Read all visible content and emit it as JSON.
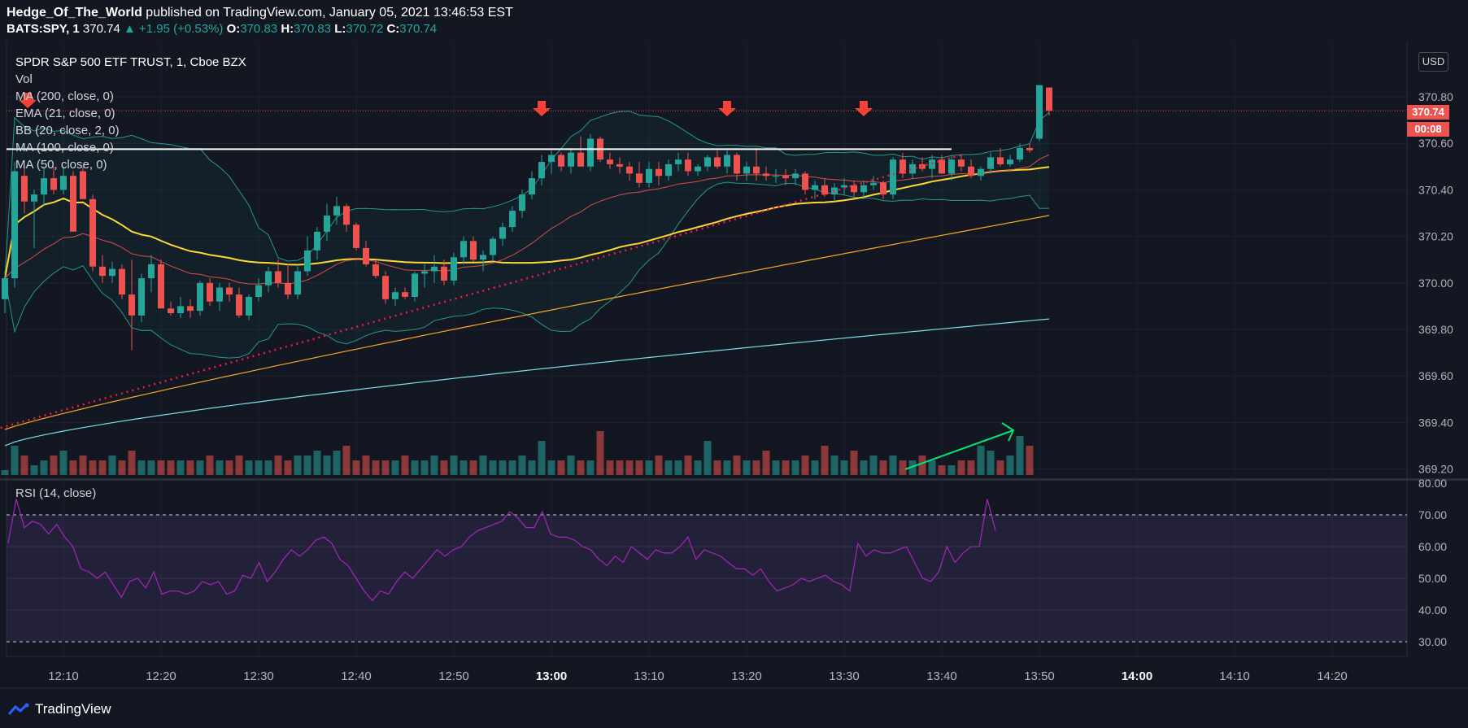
{
  "header": {
    "author": "Hedge_Of_The_World",
    "published": "published on TradingView.com, January 05, 2021 13:46:53 EST",
    "symbol": "BATS:SPY, 1",
    "last": "370.74",
    "change": "▲ +1.95 (+0.53%)",
    "o_label": "O:",
    "o_value": "370.83",
    "h_label": "H:",
    "h_value": "370.83",
    "l_label": "L:",
    "l_value": "370.72",
    "c_label": "C:",
    "c_value": "370.74"
  },
  "legend": {
    "title": "SPDR S&P 500 ETF TRUST, 1, Cboe BZX",
    "vol": "Vol",
    "ma200": "MA (200, close, 0)",
    "ema21": "EMA (21, close, 0)",
    "bb": "BB (20, close, 2, 0)",
    "ma100": "MA (100, close, 0)",
    "ma50": "MA (50, close, 0)"
  },
  "rsi_legend": "RSI (14, close)",
  "currency": "USD",
  "last_price_tag": "370.74",
  "countdown_tag": "00:08",
  "footer": {
    "brand": "TradingView"
  },
  "colors": {
    "background": "#131722",
    "up": "#26a69a",
    "down": "#ef5350",
    "ma200": "#80deea",
    "ema21": "#ef5350",
    "bb": "#26a69a",
    "ma100": "#f9a825",
    "ma50": "#fdd835",
    "rsi": "#9c27b0",
    "trendline": "#ff1744",
    "resistance": "#ffffff",
    "volume_arrow": "#00e676",
    "marker_arrow": "#f44336"
  },
  "chart_data": [
    {
      "type": "candlestick",
      "title": "SPDR S&P 500 ETF TRUST, 1, Cboe BZX",
      "y_ticks": [
        "369.20",
        "369.40",
        "369.60",
        "369.80",
        "370.00",
        "370.20",
        "370.40",
        "370.60",
        "370.80"
      ],
      "ylim": [
        369.17,
        371.0
      ],
      "x_ticks": [
        "12:10",
        "12:20",
        "12:30",
        "12:40",
        "12:50",
        "13:00",
        "13:10",
        "13:20",
        "13:30",
        "13:40",
        "13:50",
        "14:00",
        "14:10",
        "14:20"
      ],
      "x_bold_ticks": [
        "13:00",
        "14:00"
      ],
      "ohlc_start_time": "12:04",
      "ohlc": [
        [
          369.93,
          370.05,
          369.87,
          370.02
        ],
        [
          370.02,
          370.52,
          369.98,
          370.48
        ],
        [
          370.46,
          370.5,
          370.3,
          370.35
        ],
        [
          370.35,
          370.4,
          370.15,
          370.38
        ],
        [
          370.38,
          370.5,
          370.33,
          370.45
        ],
        [
          370.45,
          370.5,
          370.38,
          370.4
        ],
        [
          370.4,
          370.5,
          370.38,
          370.46
        ],
        [
          370.46,
          370.48,
          370.22,
          370.22
        ],
        [
          370.48,
          370.5,
          370.4,
          370.36
        ],
        [
          370.36,
          370.38,
          370.05,
          370.07
        ],
        [
          370.07,
          370.12,
          370.0,
          370.03
        ],
        [
          370.03,
          370.09,
          370.0,
          370.06
        ],
        [
          370.06,
          370.08,
          369.93,
          369.95
        ],
        [
          369.95,
          370.1,
          369.71,
          369.86
        ],
        [
          369.86,
          370.04,
          369.83,
          370.02
        ],
        [
          370.02,
          370.12,
          369.96,
          370.08
        ],
        [
          370.08,
          370.1,
          369.9,
          369.89
        ],
        [
          369.89,
          369.92,
          369.86,
          369.87
        ],
        [
          369.87,
          369.94,
          369.85,
          369.9
        ],
        [
          369.9,
          369.93,
          369.85,
          369.88
        ],
        [
          369.88,
          370.01,
          369.86,
          370.0
        ],
        [
          370.0,
          370.02,
          369.9,
          369.92
        ],
        [
          369.92,
          370.0,
          369.88,
          369.98
        ],
        [
          369.98,
          370.0,
          369.92,
          369.95
        ],
        [
          369.95,
          369.98,
          369.85,
          369.86
        ],
        [
          369.86,
          369.95,
          369.84,
          369.94
        ],
        [
          369.94,
          370.02,
          369.92,
          369.99
        ],
        [
          369.99,
          370.07,
          369.96,
          370.05
        ],
        [
          370.05,
          370.1,
          369.98,
          370.0
        ],
        [
          370.0,
          370.08,
          369.93,
          369.95
        ],
        [
          369.95,
          370.07,
          369.93,
          370.05
        ],
        [
          370.05,
          370.2,
          370.03,
          370.14
        ],
        [
          370.14,
          370.24,
          370.1,
          370.22
        ],
        [
          370.22,
          370.34,
          370.18,
          370.29
        ],
        [
          370.29,
          370.37,
          370.25,
          370.33
        ],
        [
          370.33,
          370.34,
          370.22,
          370.25
        ],
        [
          370.25,
          370.26,
          370.14,
          370.15
        ],
        [
          370.15,
          370.18,
          370.07,
          370.08
        ],
        [
          370.08,
          370.1,
          370.02,
          370.03
        ],
        [
          370.03,
          370.05,
          369.91,
          369.93
        ],
        [
          369.93,
          369.98,
          369.9,
          369.96
        ],
        [
          369.96,
          369.98,
          369.93,
          369.94
        ],
        [
          369.94,
          370.05,
          369.92,
          370.04
        ],
        [
          370.04,
          370.08,
          369.98,
          370.05
        ],
        [
          370.05,
          370.12,
          370.0,
          370.07
        ],
        [
          370.07,
          370.1,
          369.99,
          370.01
        ],
        [
          370.01,
          370.13,
          369.99,
          370.11
        ],
        [
          370.11,
          370.2,
          370.08,
          370.18
        ],
        [
          370.18,
          370.2,
          370.09,
          370.1
        ],
        [
          370.1,
          370.14,
          370.05,
          370.12
        ],
        [
          370.12,
          370.2,
          370.09,
          370.19
        ],
        [
          370.19,
          370.26,
          370.16,
          370.24
        ],
        [
          370.24,
          370.33,
          370.22,
          370.31
        ],
        [
          370.31,
          370.4,
          370.28,
          370.38
        ],
        [
          370.38,
          370.48,
          370.36,
          370.45
        ],
        [
          370.45,
          370.55,
          370.42,
          370.52
        ],
        [
          370.52,
          370.57,
          370.47,
          370.55
        ],
        [
          370.55,
          370.56,
          370.48,
          370.5
        ],
        [
          370.5,
          370.58,
          370.47,
          370.56
        ],
        [
          370.56,
          370.63,
          370.5,
          370.5
        ],
        [
          370.5,
          370.64,
          370.48,
          370.62
        ],
        [
          370.62,
          370.63,
          370.52,
          370.53
        ],
        [
          370.53,
          370.56,
          370.49,
          370.51
        ],
        [
          370.51,
          370.54,
          370.47,
          370.5
        ],
        [
          370.5,
          370.52,
          370.44,
          370.47
        ],
        [
          370.47,
          370.52,
          370.41,
          370.43
        ],
        [
          370.43,
          370.52,
          370.41,
          370.49
        ],
        [
          370.49,
          370.52,
          370.42,
          370.46
        ],
        [
          370.46,
          370.53,
          370.44,
          370.51
        ],
        [
          370.51,
          370.56,
          370.48,
          370.53
        ],
        [
          370.53,
          370.56,
          370.46,
          370.48
        ],
        [
          370.48,
          370.51,
          370.46,
          370.5
        ],
        [
          370.5,
          370.55,
          370.48,
          370.54
        ],
        [
          370.54,
          370.57,
          370.49,
          370.5
        ],
        [
          370.5,
          370.57,
          370.47,
          370.55
        ],
        [
          370.55,
          370.56,
          370.44,
          370.47
        ],
        [
          370.47,
          370.52,
          370.44,
          370.5
        ],
        [
          370.5,
          370.58,
          370.44,
          370.47
        ],
        [
          370.47,
          370.5,
          370.44,
          370.46
        ],
        [
          370.46,
          370.49,
          370.43,
          370.46
        ],
        [
          370.46,
          370.49,
          370.42,
          370.45
        ],
        [
          370.45,
          370.49,
          370.42,
          370.47
        ],
        [
          370.47,
          370.48,
          370.38,
          370.4
        ],
        [
          370.4,
          370.44,
          370.36,
          370.42
        ],
        [
          370.42,
          370.45,
          370.37,
          370.38
        ],
        [
          370.38,
          370.43,
          370.35,
          370.41
        ],
        [
          370.41,
          370.45,
          370.38,
          370.42
        ],
        [
          370.42,
          370.44,
          370.37,
          370.39
        ],
        [
          370.39,
          370.44,
          370.36,
          370.42
        ],
        [
          370.42,
          370.46,
          370.4,
          370.43
        ],
        [
          370.43,
          370.44,
          370.36,
          370.38
        ],
        [
          370.38,
          370.54,
          370.36,
          370.53
        ],
        [
          370.53,
          370.56,
          370.45,
          370.47
        ],
        [
          370.47,
          370.53,
          370.45,
          370.51
        ],
        [
          370.51,
          370.54,
          370.48,
          370.49
        ],
        [
          370.49,
          370.55,
          370.45,
          370.53
        ],
        [
          370.53,
          370.55,
          370.47,
          370.47
        ],
        [
          370.47,
          370.55,
          370.44,
          370.53
        ],
        [
          370.53,
          370.55,
          370.48,
          370.5
        ],
        [
          370.5,
          370.53,
          370.45,
          370.46
        ],
        [
          370.46,
          370.5,
          370.44,
          370.49
        ],
        [
          370.49,
          370.56,
          370.47,
          370.54
        ],
        [
          370.54,
          370.58,
          370.5,
          370.51
        ],
        [
          370.51,
          370.55,
          370.5,
          370.53
        ],
        [
          370.53,
          370.6,
          370.52,
          370.58
        ],
        [
          370.58,
          370.6,
          370.56,
          370.57
        ],
        [
          370.62,
          370.85,
          370.61,
          370.85
        ],
        [
          370.84,
          370.84,
          370.72,
          370.74
        ]
      ],
      "volume_ticks": [
        1,
        6,
        4,
        2,
        3,
        4,
        5,
        3,
        4,
        3,
        3,
        4,
        3,
        5,
        3,
        3,
        3,
        3,
        3,
        3,
        3,
        4,
        3,
        3,
        4,
        3,
        3,
        3,
        4,
        3,
        4,
        4,
        5,
        4,
        5,
        6,
        3,
        4,
        3,
        3,
        3,
        4,
        3,
        3,
        4,
        3,
        4,
        3,
        3,
        4,
        3,
        3,
        3,
        4,
        3,
        7,
        3,
        3,
        4,
        3,
        3,
        9,
        3,
        3,
        3,
        3,
        3,
        4,
        3,
        3,
        4,
        3,
        7,
        3,
        3,
        4,
        3,
        3,
        5,
        3,
        3,
        3,
        4,
        3,
        6,
        4,
        3,
        5,
        3,
        4,
        3,
        4,
        3,
        3,
        4,
        3,
        2,
        2,
        3,
        3,
        6,
        5,
        3,
        4,
        8,
        6
      ]
    },
    {
      "type": "line",
      "title": "RSI (14, close)",
      "y_ticks": [
        "30.00",
        "40.00",
        "50.00",
        "60.00",
        "70.00",
        "80.00"
      ],
      "ylim": [
        27,
        81
      ],
      "bands": [
        30,
        70
      ],
      "values": [
        61,
        75,
        66,
        68,
        67,
        64,
        67,
        63,
        60,
        53,
        52,
        50,
        52,
        48,
        44,
        49,
        50,
        47,
        52,
        45,
        46,
        46,
        45,
        46,
        49,
        48,
        49,
        45,
        46,
        51,
        50,
        55,
        49,
        52,
        56,
        59,
        57,
        59,
        62,
        63,
        61,
        56,
        54,
        50,
        46,
        43,
        46,
        45,
        49,
        52,
        50,
        53,
        56,
        59,
        57,
        59,
        60,
        63,
        65,
        66,
        67,
        68,
        71,
        69,
        66,
        66,
        71,
        64,
        63,
        63,
        62,
        60,
        59,
        56,
        54,
        57,
        55,
        60,
        58,
        56,
        59,
        58,
        58,
        60,
        63,
        56,
        59,
        58,
        57,
        55,
        53,
        53,
        51,
        53,
        49,
        46,
        47,
        48,
        50,
        49,
        50,
        51,
        49,
        48,
        46,
        61,
        57,
        59,
        58,
        58,
        59,
        60,
        55,
        50,
        49,
        52,
        60,
        55,
        58,
        60,
        60,
        75,
        65
      ]
    }
  ],
  "annotations": {
    "marker_arrows": 4,
    "resistance_level": 370.575,
    "trendline_from": [
      369.37,
      "12:03"
    ],
    "trendline_to": [
      370.55,
      "13:42"
    ]
  }
}
